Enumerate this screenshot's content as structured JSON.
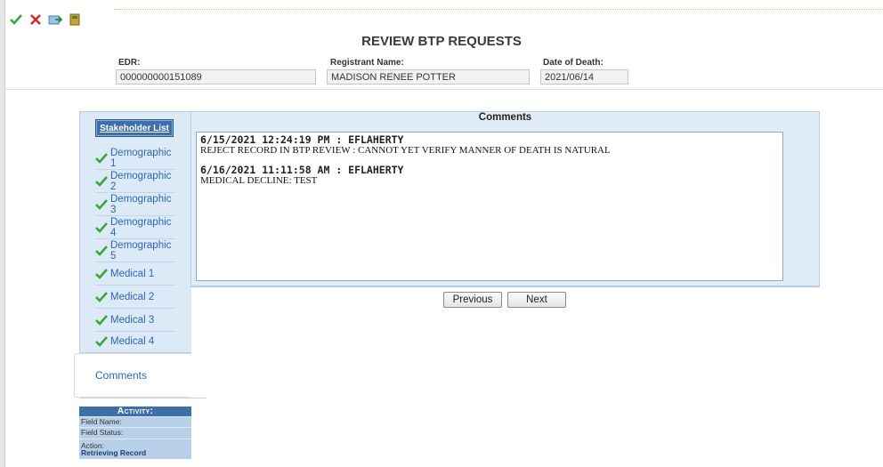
{
  "toolbar": {
    "icons": [
      "check-icon",
      "x-icon",
      "export-icon",
      "book-icon"
    ]
  },
  "title": "REVIEW BTP REQUESTS",
  "header": {
    "edr_label": "EDR:",
    "edr_value": "000000000151089",
    "registrant_label": "Registrant Name:",
    "registrant_value": "MADISON RENEE POTTER",
    "dod_label": "Date of Death:",
    "dod_value": "2021/06/14"
  },
  "sidebar": {
    "stakeholder_button": "Stakeholder List",
    "items": [
      {
        "label": "Demographic 1"
      },
      {
        "label": "Demographic 2"
      },
      {
        "label": "Demographic 3"
      },
      {
        "label": "Demographic 4"
      },
      {
        "label": "Demographic 5"
      },
      {
        "label": "Medical 1"
      },
      {
        "label": "Medical 2"
      },
      {
        "label": "Medical 3"
      },
      {
        "label": "Medical 4"
      }
    ],
    "active_tab": "Comments"
  },
  "comments": {
    "title": "Comments",
    "entries": [
      {
        "header": "6/15/2021 12:24:19 PM : EFLAHERTY",
        "text": "REJECT RECORD IN BTP REVIEW : CANNOT YET VERIFY MANNER OF DEATH IS NATURAL"
      },
      {
        "header": "6/16/2021 11:11:58 AM : EFLAHERTY",
        "text": "MEDICAL DECLINE: TEST"
      }
    ]
  },
  "nav": {
    "previous": "Previous",
    "next": "Next"
  },
  "activity": {
    "title": "Activity:",
    "field_name_label": "Field Name:",
    "field_status_label": "Field Status:",
    "action_label": "Action:",
    "action_value": "Retrieving Record"
  },
  "colors": {
    "accent": "#3f6fa8",
    "check": "#3aa63a",
    "link": "#2b67b3"
  }
}
